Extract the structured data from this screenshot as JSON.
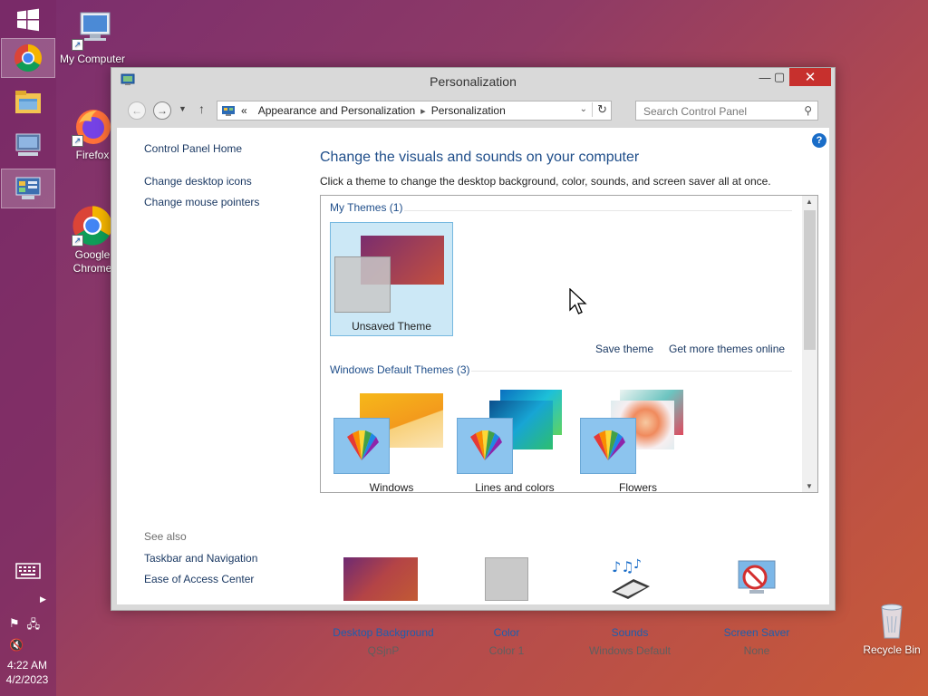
{
  "desktop": {
    "icons": [
      {
        "label": "My Computer"
      },
      {
        "label": "Firefox"
      },
      {
        "label": "Google Chrome"
      },
      {
        "label": "Recycle Bin"
      }
    ]
  },
  "taskbar": {
    "clock_time": "4:22 AM",
    "clock_date": "4/2/2023"
  },
  "window": {
    "title": "Personalization",
    "address": {
      "prefix": "«",
      "crumb1": "Appearance and Personalization",
      "crumb2": "Personalization"
    },
    "search_placeholder": "Search Control Panel"
  },
  "left_nav": {
    "home": "Control Panel Home",
    "items": [
      "Change desktop icons",
      "Change mouse pointers"
    ],
    "see_also_heading": "See also",
    "see_also": [
      "Taskbar and Navigation",
      "Ease of Access Center"
    ]
  },
  "main": {
    "title": "Change the visuals and sounds on your computer",
    "subtitle": "Click a theme to change the desktop background, color, sounds, and screen saver all at once.",
    "my_themes_label": "My Themes (1)",
    "my_themes": [
      {
        "name": "Unsaved Theme"
      }
    ],
    "save_theme": "Save theme",
    "get_more": "Get more themes online",
    "default_themes_label": "Windows Default Themes (3)",
    "default_themes": [
      {
        "name": "Windows"
      },
      {
        "name": "Lines and colors"
      },
      {
        "name": "Flowers"
      }
    ]
  },
  "bottom": [
    {
      "label": "Desktop Background",
      "value": "QSjnP"
    },
    {
      "label": "Color",
      "value": "Color 1"
    },
    {
      "label": "Sounds",
      "value": "Windows Default"
    },
    {
      "label": "Screen Saver",
      "value": "None"
    }
  ]
}
